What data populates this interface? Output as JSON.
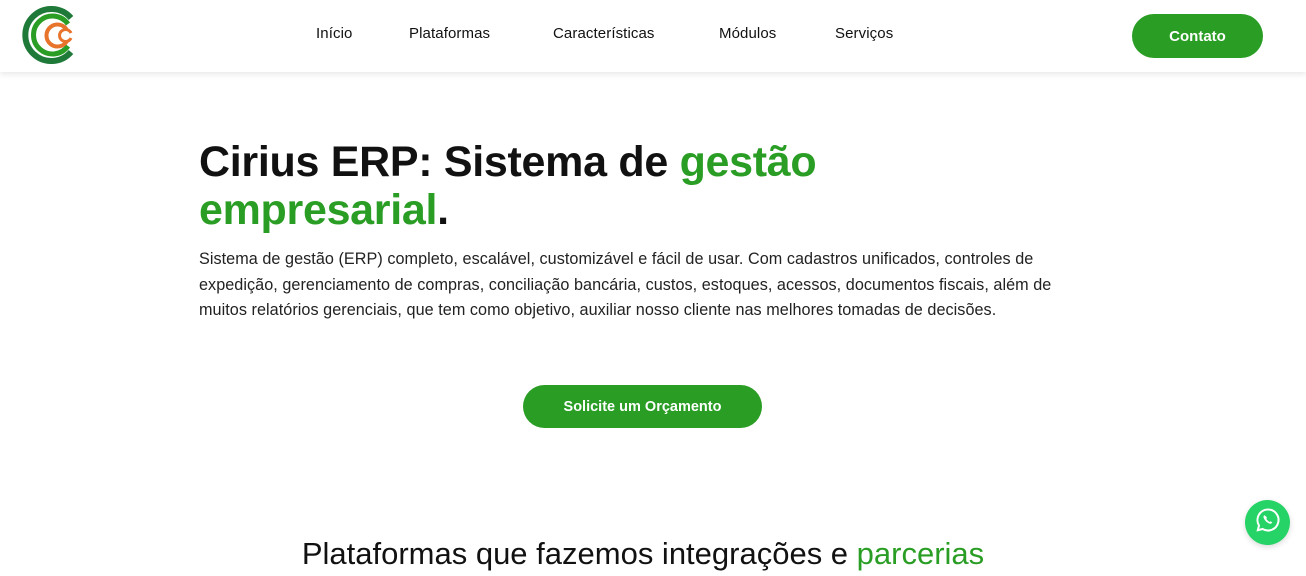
{
  "brand": {
    "logo_icon": "cirius-logo-icon",
    "colors": {
      "primary_green": "#2a9d25",
      "dark_green": "#1f7a3a",
      "accent_orange": "#e8732a",
      "whatsapp_green": "#25d366"
    }
  },
  "nav": {
    "items": [
      {
        "label": "Início"
      },
      {
        "label": "Plataformas"
      },
      {
        "label": "Características"
      },
      {
        "label": "Módulos"
      },
      {
        "label": "Serviços"
      }
    ],
    "cta_label": "Contato"
  },
  "hero": {
    "title_part1": "Cirius ERP: Sistema de ",
    "title_green1": "gestão",
    "title_green2": "empresarial",
    "title_end": ".",
    "description": "Sistema de gestão (ERP) completo, escalável, customizável e fácil de usar. Com cadastros unificados, controles de expedição, gerenciamento de compras, conciliação bancária, custos, estoques, acessos, documentos fiscais, além de muitos relatórios gerenciais, que tem como objetivo, auxiliar nosso cliente nas melhores tomadas de decisões.",
    "cta_label": "Solicite um Orçamento"
  },
  "platforms": {
    "title_part1": "Plataformas que fazemos integrações e ",
    "title_green": "parcerias"
  },
  "floating": {
    "whatsapp_icon": "whatsapp-icon"
  }
}
